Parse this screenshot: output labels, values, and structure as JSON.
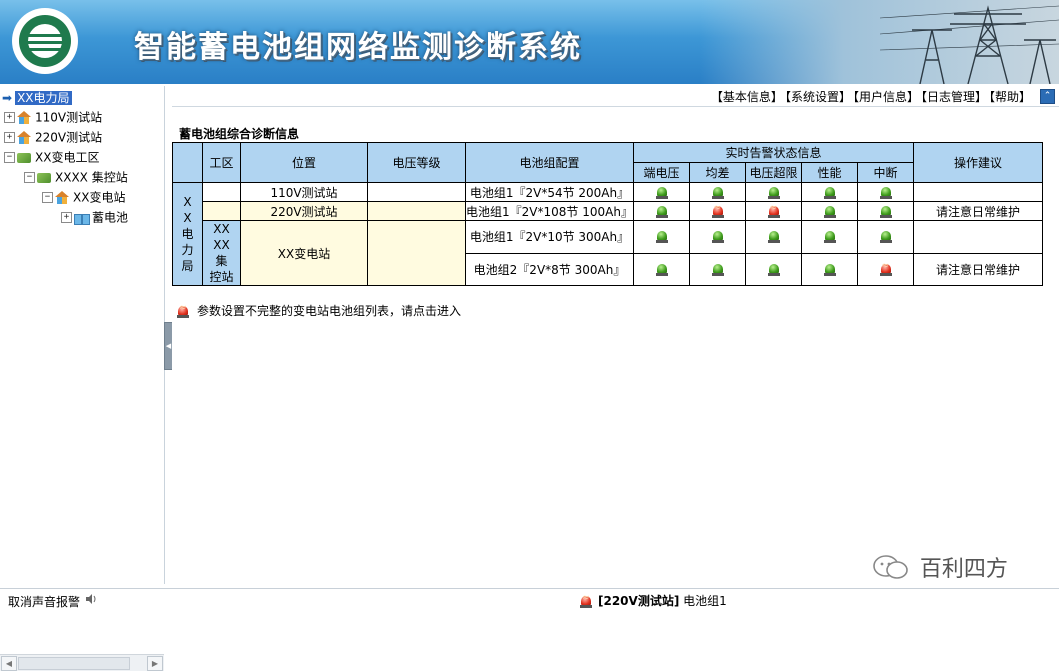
{
  "header": {
    "title": "智能蓄电池组网络监测诊断系统"
  },
  "tree": {
    "root": "XX电力局",
    "items": [
      {
        "label": "110V测试站"
      },
      {
        "label": "220V测试站"
      },
      {
        "label": "XX变电工区"
      },
      {
        "label": "XXXX 集控站"
      },
      {
        "label": "XX变电站"
      },
      {
        "label": "蓄电池"
      }
    ]
  },
  "topnav": {
    "items": [
      "【基本信息】",
      "【系统设置】",
      "【用户信息】",
      "【日志管理】",
      "【帮助】"
    ],
    "collapse_icon": "chevron-up"
  },
  "main": {
    "section_title": "蓄电池组综合诊断信息",
    "table": {
      "headers": {
        "area": "工区",
        "location": "位置",
        "voltage_level": "电压等级",
        "config": "电池组配置",
        "alarm_group": "实时告警状态信息",
        "suggestion": "操作建议",
        "alarms": [
          "端电压",
          "均差",
          "电压超限",
          "性能",
          "中断"
        ]
      },
      "bureau": "XX电力局",
      "bureau_chars": [
        "X",
        "X",
        "电",
        "力",
        "局"
      ],
      "group_area": "XX XX 集控站",
      "group_area_lines": [
        "XX",
        "XX",
        "集",
        "控站"
      ],
      "group_location": "XX变电站",
      "rows": [
        {
          "location": "110V测试站",
          "voltage": "",
          "config": "电池组1『2V*54节 200Ah』",
          "status": [
            "green",
            "green",
            "green",
            "green",
            "green"
          ],
          "suggestion": ""
        },
        {
          "location": "220V测试站",
          "voltage": "",
          "config": "电池组1『2V*108节 100Ah』",
          "status": [
            "green",
            "red",
            "red",
            "green",
            "green"
          ],
          "suggestion": "请注意日常维护"
        },
        {
          "config": "电池组1『2V*10节 300Ah』",
          "status": [
            "green",
            "green",
            "green",
            "green",
            "green"
          ],
          "suggestion": ""
        },
        {
          "config": "电池组2『2V*8节 300Ah』",
          "status": [
            "green",
            "green",
            "green",
            "green",
            "red"
          ],
          "suggestion": "请注意日常维护"
        }
      ]
    },
    "note": "参数设置不完整的变电站电池组列表，请点击进入"
  },
  "statusbar": {
    "mute_label": "取消声音报警",
    "alarm_station": "[220V测试站]",
    "alarm_group": "电池组1"
  },
  "watermark": "百利四方"
}
